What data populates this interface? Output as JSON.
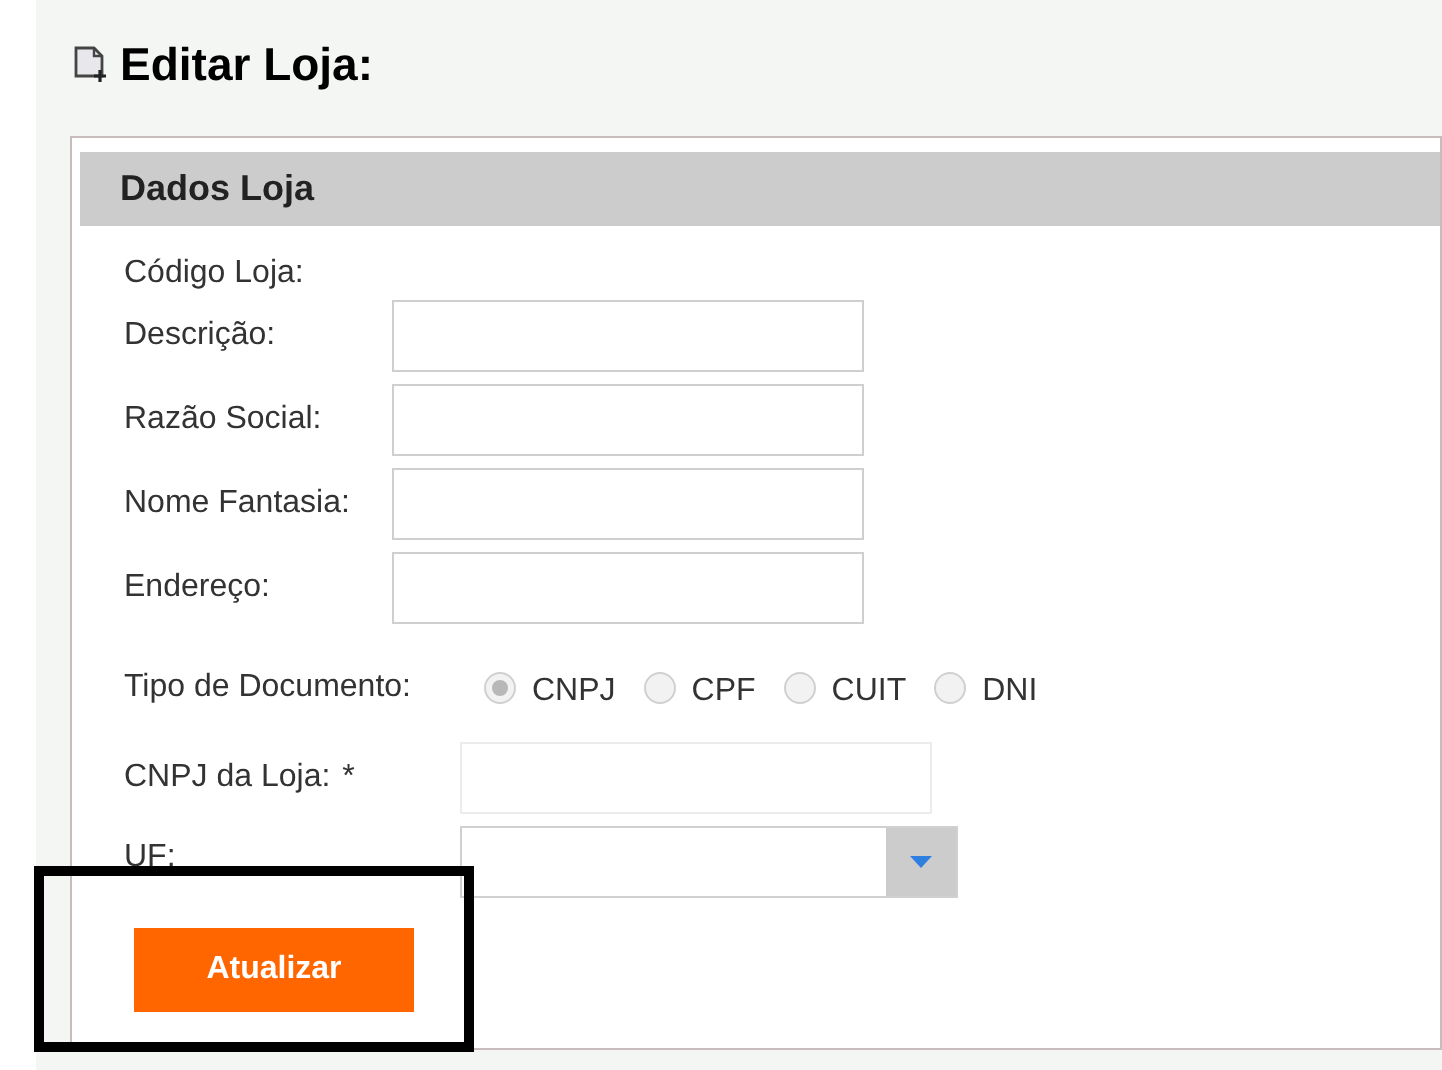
{
  "page": {
    "title": "Editar Loja:"
  },
  "panel": {
    "title": "Dados Loja",
    "code_label": "Código Loja:",
    "fields": [
      {
        "label": "Descrição:"
      },
      {
        "label": "Razão Social:"
      },
      {
        "label": "Nome Fantasia:"
      },
      {
        "label": "Endereço:"
      }
    ],
    "document_type": {
      "label": "Tipo de Documento:",
      "options": [
        {
          "label": "CNPJ",
          "selected": true,
          "disabled": true
        },
        {
          "label": "CPF",
          "selected": false,
          "disabled": true
        },
        {
          "label": "CUIT",
          "selected": false,
          "disabled": true
        },
        {
          "label": "DNI",
          "selected": false,
          "disabled": true
        }
      ]
    },
    "document_field": {
      "label": "CNPJ da Loja:",
      "required_mark": "*"
    },
    "uf_field": {
      "label": "UF:"
    },
    "submit": {
      "label": "Atualizar"
    }
  }
}
